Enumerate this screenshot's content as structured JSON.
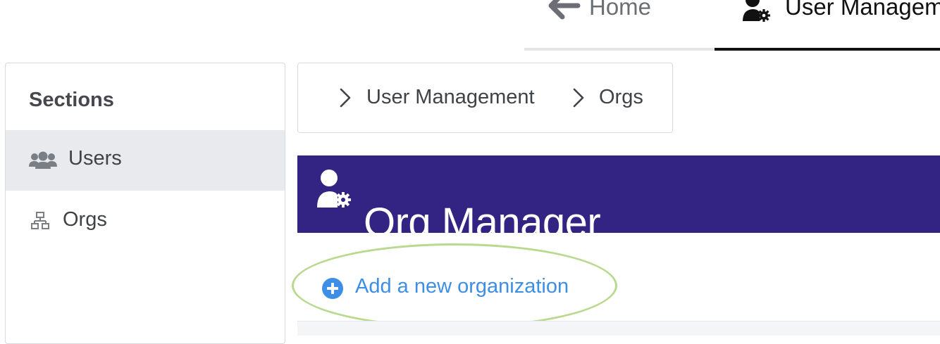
{
  "top_tabs": {
    "home_label": "Home",
    "user_management_label": "User Management"
  },
  "sidebar": {
    "heading": "Sections",
    "items": [
      {
        "label": "Users",
        "icon": "users-icon",
        "active": true
      },
      {
        "label": "Orgs",
        "icon": "sitemap-icon",
        "active": false
      }
    ]
  },
  "breadcrumb": {
    "items": [
      "User Management",
      "Orgs"
    ]
  },
  "banner": {
    "title": "Org Manager",
    "icon": "user-gear-icon",
    "color": "#332483"
  },
  "actions": {
    "add_label": "Add a new organization",
    "add_icon": "plus-circle-icon",
    "link_color": "#3d8ee6"
  }
}
